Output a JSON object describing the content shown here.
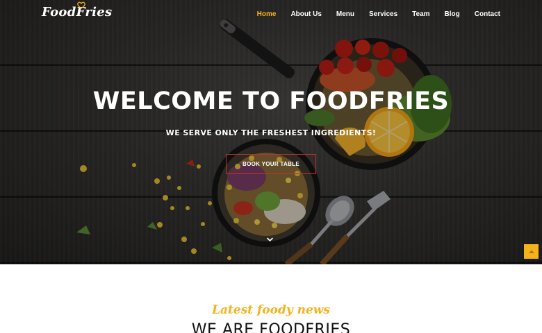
{
  "brand": {
    "logo_text": "FoodFries",
    "accent_color": "#f5b21a",
    "button_border_color": "#c0322a"
  },
  "nav": {
    "items": [
      {
        "label": "Home",
        "active": true
      },
      {
        "label": "About Us",
        "active": false
      },
      {
        "label": "Menu",
        "active": false
      },
      {
        "label": "Services",
        "active": false
      },
      {
        "label": "Team",
        "active": false
      },
      {
        "label": "Blog",
        "active": false
      },
      {
        "label": "Contact",
        "active": false
      }
    ]
  },
  "hero": {
    "title": "WELCOME TO FOODFRIES",
    "subtitle": "WE SERVE ONLY THE FRESHEST INGREDIENTS!",
    "cta_label": "BOOK YOUR TABLE",
    "scroll_icon": "chevron-down-icon"
  },
  "back_to_top": {
    "icon": "arrow-up-icon"
  },
  "news_section": {
    "label": "Latest foody news",
    "heading": "WE ARE FOODFRIES"
  }
}
